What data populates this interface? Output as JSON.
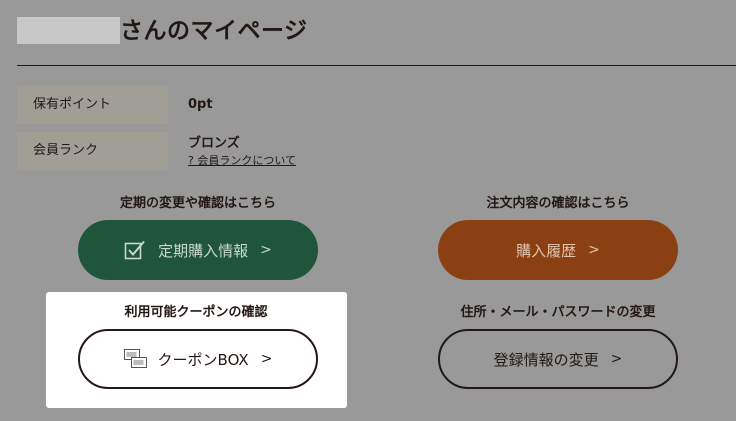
{
  "header": {
    "title": "さんのマイページ"
  },
  "info": {
    "points_label": "保有ポイント",
    "points_value": "0pt",
    "rank_label": "会員ランク",
    "rank_value": "ブロンズ",
    "rank_link": "? 会員ランクについて"
  },
  "sections": {
    "subscription": {
      "heading": "定期の変更や確認はこちら",
      "button": "定期購入情報",
      "chevron": ">"
    },
    "orders": {
      "heading": "注文内容の確認はこちら",
      "button": "購入履歴",
      "chevron": ">"
    },
    "coupon": {
      "heading": "利用可能クーポンの確認",
      "button": "クーポンBOX",
      "chevron": ">"
    },
    "account": {
      "heading": "住所・メール・パスワードの変更",
      "button": "登録情報の変更",
      "chevron": ">"
    }
  },
  "icons": {
    "subscription": "checkbox-icon",
    "coupon": "coupon-ticket-icon"
  },
  "colors": {
    "background": "#999999",
    "text": "#231815",
    "subscription_button": "#1f553b",
    "orders_button": "#8b4014",
    "label_cell": "#a19e95",
    "coupon_panel": "#ffffff"
  }
}
